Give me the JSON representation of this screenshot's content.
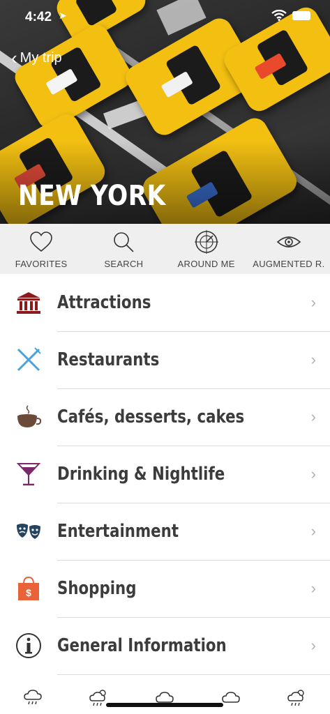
{
  "status_bar": {
    "time": "4:42"
  },
  "nav": {
    "back_label": "My trip"
  },
  "hero": {
    "city": "NEW YORK"
  },
  "toolbar": [
    {
      "label": "FAVORITES",
      "icon": "heart-icon"
    },
    {
      "label": "SEARCH",
      "icon": "search-icon"
    },
    {
      "label": "AROUND ME",
      "icon": "radar-icon"
    },
    {
      "label": "AUGMENTED R.",
      "icon": "eye-icon"
    }
  ],
  "categories": [
    {
      "label": "Attractions",
      "icon": "museum-icon",
      "color": "#8b1a1a"
    },
    {
      "label": "Restaurants",
      "icon": "fork-knife-icon",
      "color": "#4aa3df"
    },
    {
      "label": "Cafés, desserts, cakes",
      "icon": "coffee-cup-icon",
      "color": "#6b4a3a"
    },
    {
      "label": "Drinking & Nightlife",
      "icon": "cocktail-icon",
      "color": "#7a2a6a"
    },
    {
      "label": "Entertainment",
      "icon": "theater-masks-icon",
      "color": "#24445f"
    },
    {
      "label": "Shopping",
      "icon": "shopping-bag-icon",
      "color": "#e8623a"
    },
    {
      "label": "General Information",
      "icon": "info-icon",
      "color": "#333333"
    }
  ],
  "weather_icons": [
    "rain-cloud-icon",
    "sun-rain-icon",
    "cloud-icon",
    "cloud-icon",
    "sun-rain-icon"
  ]
}
